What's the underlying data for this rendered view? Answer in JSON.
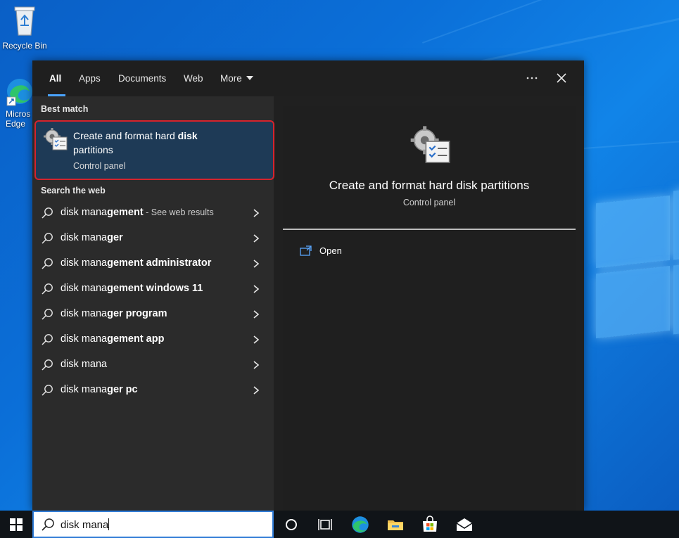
{
  "desktop": {
    "recycle_bin_label": "Recycle Bin",
    "edge_label_line1": "Micros",
    "edge_label_line2": "Edge"
  },
  "tabs": [
    {
      "label": "All",
      "active": true
    },
    {
      "label": "Apps"
    },
    {
      "label": "Documents"
    },
    {
      "label": "Web"
    },
    {
      "label": "More"
    }
  ],
  "toolbar_icons": [
    "more-options-icon",
    "close-icon"
  ],
  "best_match": {
    "heading": "Best match",
    "title_plain": "Create and format hard ",
    "title_bold": "disk",
    "title_tail": "partitions",
    "subtitle": "Control panel",
    "icon": "disk-management-gear-icon"
  },
  "web": {
    "heading": "Search the web",
    "items": [
      {
        "prefix": "disk mana",
        "bold": "gement",
        "hint": " - See web results"
      },
      {
        "prefix": "disk mana",
        "bold": "ger",
        "hint": ""
      },
      {
        "prefix": "disk mana",
        "bold": "gement administrator",
        "hint": ""
      },
      {
        "prefix": "disk mana",
        "bold": "gement windows 11",
        "hint": ""
      },
      {
        "prefix": "disk mana",
        "bold": "ger program",
        "hint": ""
      },
      {
        "prefix": "disk mana",
        "bold": "gement app",
        "hint": ""
      },
      {
        "prefix": "disk mana",
        "bold": "",
        "hint": ""
      },
      {
        "prefix": "disk mana",
        "bold": "ger pc",
        "hint": ""
      }
    ]
  },
  "preview": {
    "title": "Create and format hard disk partitions",
    "subtitle": "Control panel",
    "action_open": "Open"
  },
  "taskbar": {
    "search_value": "disk mana",
    "icons": [
      "windows-start-icon",
      "cortana-icon",
      "task-view-icon",
      "edge-icon",
      "file-explorer-icon",
      "store-icon",
      "mail-icon"
    ]
  },
  "colors": {
    "accent": "#4aa3ff",
    "highlight_border": "#d6232c",
    "selected_bg": "#1e3a56"
  }
}
